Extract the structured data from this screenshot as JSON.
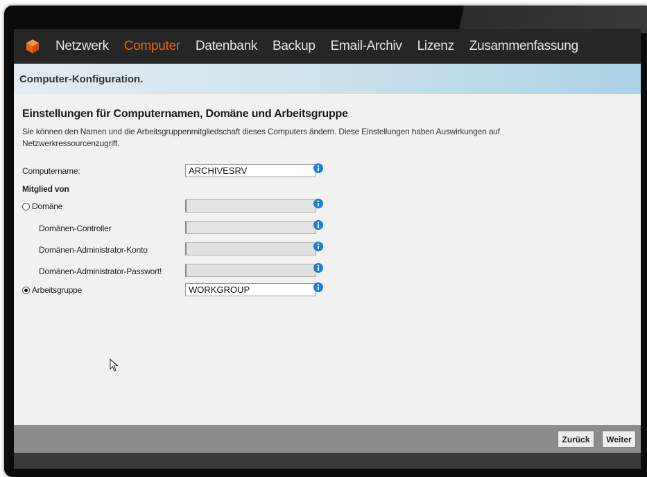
{
  "nav": {
    "items": [
      {
        "label": "Netzwerk",
        "active": false
      },
      {
        "label": "Computer",
        "active": true
      },
      {
        "label": "Datenbank",
        "active": false
      },
      {
        "label": "Backup",
        "active": false
      },
      {
        "label": "Email-Archiv",
        "active": false
      },
      {
        "label": "Lizenz",
        "active": false
      },
      {
        "label": "Zusammenfassung",
        "active": false
      }
    ],
    "active_color": "#e8651a"
  },
  "page": {
    "title": "Computer-Konfiguration."
  },
  "section": {
    "title": "Einstellungen für Computernamen, Domäne und Arbeitsgruppe",
    "description": "Sie können den Namen und die Arbeitsgruppenmitgliedschaft dieses Computers ändern. Diese Einstellungen haben Auswirkungen auf Netzwerkressourcenzugriff."
  },
  "form": {
    "computername_label": "Computername:",
    "computername_value": "ARCHIVESRV",
    "member_of_label": "Mitglied von",
    "domain_label": "Domäne",
    "domain_value": "",
    "domain_controller_label": "Domänen-Controller",
    "domain_controller_value": "",
    "domain_admin_label": "Domänen-Administrator-Konto",
    "domain_admin_value": "",
    "domain_password_label": "Domänen-Administrator-Passwort!",
    "domain_password_value": "",
    "workgroup_label": "Arbeitsgruppe",
    "workgroup_value": "WORKGROUP",
    "selected": "workgroup"
  },
  "footer": {
    "back_label": "Zurück",
    "next_label": "Weiter"
  },
  "colors": {
    "info_icon": "#1d7fd6",
    "header_bg": "#262626"
  }
}
